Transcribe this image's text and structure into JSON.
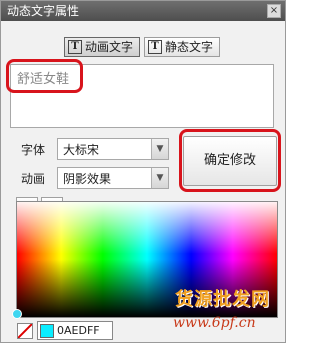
{
  "window": {
    "title": "动态文字属性",
    "close_glyph": "×"
  },
  "tabs": [
    {
      "label": "动画文字",
      "icon": "T",
      "active": true
    },
    {
      "label": "静态文字",
      "icon": "T",
      "active": false
    }
  ],
  "text_input": {
    "value": "舒适女鞋"
  },
  "font": {
    "label": "字体",
    "value": "大标宋"
  },
  "animation": {
    "label": "动画",
    "value": "阴影效果"
  },
  "confirm_button": {
    "label": "确定修改"
  },
  "flip_buttons": {
    "horizontal": "◂|▸",
    "vertical": "⬍"
  },
  "color": {
    "hex": "0AEDFF",
    "swatch": "#0AEDFF"
  },
  "watermark": {
    "line1": "货源批发网",
    "line2": "www.6pf.cn"
  },
  "colors": {
    "highlight_red": "#d8141c",
    "titlebar": "#555555"
  }
}
